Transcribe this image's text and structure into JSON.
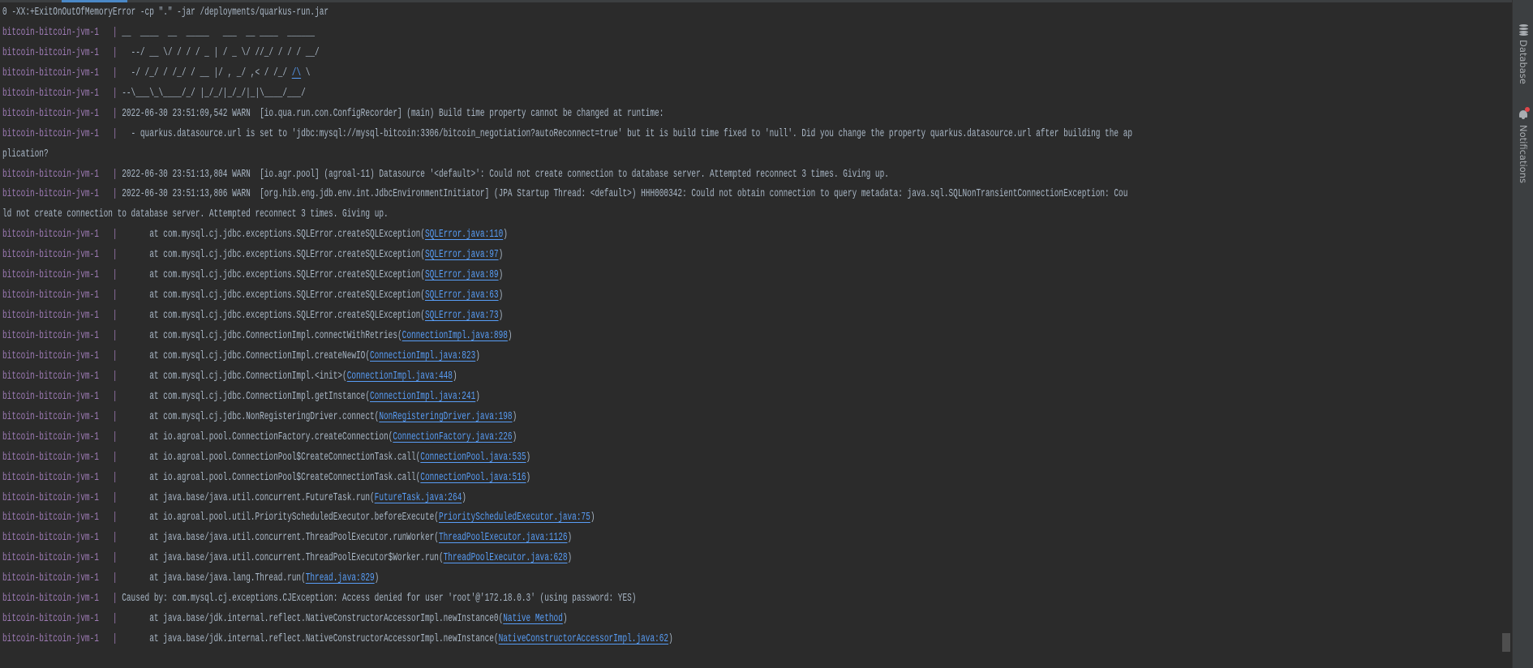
{
  "colors": {
    "background": "#2b2b2b",
    "text": "#a9b7c6",
    "prefix": "#9e7bb5",
    "link": "#589df6",
    "sidebar": "#3c3f41",
    "notification_dot": "#e0464a"
  },
  "sidebar": {
    "items": [
      {
        "label": "Database",
        "icon": "database-icon"
      },
      {
        "label": "Notifications",
        "icon": "bell-icon",
        "has_badge": true
      }
    ]
  },
  "console": {
    "lines": [
      {
        "msg": "0 -XX:+ExitOnOutOfMemoryError -cp \".\" -jar /deployments/quarkus-run.jar"
      },
      {
        "prefix": "bitcoin-bitcoin-jvm-1",
        "sep": "|",
        "msg": "__  ____  __  _____   ___  __ ____  ______"
      },
      {
        "prefix": "bitcoin-bitcoin-jvm-1",
        "sep": "|",
        "msg": "  --/ __ \\/ / / / _ | / _ \\/ //_/ / / / __/"
      },
      {
        "prefix": "bitcoin-bitcoin-jvm-1",
        "sep": "|",
        "msg": "  -/ /_/ / /_/ / __ |/ , _/ ,< / /_/ ",
        "link": "/\\",
        "tail": " \\"
      },
      {
        "prefix": "bitcoin-bitcoin-jvm-1",
        "sep": "|",
        "msg": "--\\___\\_\\____/_/ |_/_/|_/_/|_|\\____/___/"
      },
      {
        "prefix": "bitcoin-bitcoin-jvm-1",
        "sep": "|",
        "msg": "2022-06-30 23:51:09,542 WARN  [io.qua.run.con.ConfigRecorder] (main) Build time property cannot be changed at runtime:"
      },
      {
        "prefix": "bitcoin-bitcoin-jvm-1",
        "sep": "|",
        "msg": "  - quarkus.datasource.url is set to 'jdbc:mysql://mysql-bitcoin:3306/bitcoin_negotiation?autoReconnect=true' but it is build time fixed to 'null'. Did you change the property quarkus.datasource.url after building the ap"
      },
      {
        "msg": "plication?"
      },
      {
        "prefix": "bitcoin-bitcoin-jvm-1",
        "sep": "|",
        "msg": "2022-06-30 23:51:13,804 WARN  [io.agr.pool] (agroal-11) Datasource '<default>': Could not create connection to database server. Attempted reconnect 3 times. Giving up."
      },
      {
        "prefix": "bitcoin-bitcoin-jvm-1",
        "sep": "|",
        "msg": "2022-06-30 23:51:13,806 WARN  [org.hib.eng.jdb.env.int.JdbcEnvironmentInitiator] (JPA Startup Thread: <default>) HHH000342: Could not obtain connection to query metadata: java.sql.SQLNonTransientConnectionException: Cou"
      },
      {
        "msg": "ld not create connection to database server. Attempted reconnect 3 times. Giving up."
      },
      {
        "prefix": "bitcoin-bitcoin-jvm-1",
        "sep": "|",
        "msg": "      at com.mysql.cj.jdbc.exceptions.SQLError.createSQLException(",
        "link": "SQLError.java:110",
        "tail": ")"
      },
      {
        "prefix": "bitcoin-bitcoin-jvm-1",
        "sep": "|",
        "msg": "      at com.mysql.cj.jdbc.exceptions.SQLError.createSQLException(",
        "link": "SQLError.java:97",
        "tail": ")"
      },
      {
        "prefix": "bitcoin-bitcoin-jvm-1",
        "sep": "|",
        "msg": "      at com.mysql.cj.jdbc.exceptions.SQLError.createSQLException(",
        "link": "SQLError.java:89",
        "tail": ")"
      },
      {
        "prefix": "bitcoin-bitcoin-jvm-1",
        "sep": "|",
        "msg": "      at com.mysql.cj.jdbc.exceptions.SQLError.createSQLException(",
        "link": "SQLError.java:63",
        "tail": ")"
      },
      {
        "prefix": "bitcoin-bitcoin-jvm-1",
        "sep": "|",
        "msg": "      at com.mysql.cj.jdbc.exceptions.SQLError.createSQLException(",
        "link": "SQLError.java:73",
        "tail": ")"
      },
      {
        "prefix": "bitcoin-bitcoin-jvm-1",
        "sep": "|",
        "msg": "      at com.mysql.cj.jdbc.ConnectionImpl.connectWithRetries(",
        "link": "ConnectionImpl.java:898",
        "tail": ")"
      },
      {
        "prefix": "bitcoin-bitcoin-jvm-1",
        "sep": "|",
        "msg": "      at com.mysql.cj.jdbc.ConnectionImpl.createNewIO(",
        "link": "ConnectionImpl.java:823",
        "tail": ")"
      },
      {
        "prefix": "bitcoin-bitcoin-jvm-1",
        "sep": "|",
        "msg": "      at com.mysql.cj.jdbc.ConnectionImpl.<init>(",
        "link": "ConnectionImpl.java:448",
        "tail": ")"
      },
      {
        "prefix": "bitcoin-bitcoin-jvm-1",
        "sep": "|",
        "msg": "      at com.mysql.cj.jdbc.ConnectionImpl.getInstance(",
        "link": "ConnectionImpl.java:241",
        "tail": ")"
      },
      {
        "prefix": "bitcoin-bitcoin-jvm-1",
        "sep": "|",
        "msg": "      at com.mysql.cj.jdbc.NonRegisteringDriver.connect(",
        "link": "NonRegisteringDriver.java:198",
        "tail": ")"
      },
      {
        "prefix": "bitcoin-bitcoin-jvm-1",
        "sep": "|",
        "msg": "      at io.agroal.pool.ConnectionFactory.createConnection(",
        "link": "ConnectionFactory.java:226",
        "tail": ")"
      },
      {
        "prefix": "bitcoin-bitcoin-jvm-1",
        "sep": "|",
        "msg": "      at io.agroal.pool.ConnectionPool$CreateConnectionTask.call(",
        "link": "ConnectionPool.java:535",
        "tail": ")"
      },
      {
        "prefix": "bitcoin-bitcoin-jvm-1",
        "sep": "|",
        "msg": "      at io.agroal.pool.ConnectionPool$CreateConnectionTask.call(",
        "link": "ConnectionPool.java:516",
        "tail": ")"
      },
      {
        "prefix": "bitcoin-bitcoin-jvm-1",
        "sep": "|",
        "msg": "      at java.base/java.util.concurrent.FutureTask.run(",
        "link": "FutureTask.java:264",
        "tail": ")"
      },
      {
        "prefix": "bitcoin-bitcoin-jvm-1",
        "sep": "|",
        "msg": "      at io.agroal.pool.util.PriorityScheduledExecutor.beforeExecute(",
        "link": "PriorityScheduledExecutor.java:75",
        "tail": ")"
      },
      {
        "prefix": "bitcoin-bitcoin-jvm-1",
        "sep": "|",
        "msg": "      at java.base/java.util.concurrent.ThreadPoolExecutor.runWorker(",
        "link": "ThreadPoolExecutor.java:1126",
        "tail": ")"
      },
      {
        "prefix": "bitcoin-bitcoin-jvm-1",
        "sep": "|",
        "msg": "      at java.base/java.util.concurrent.ThreadPoolExecutor$Worker.run(",
        "link": "ThreadPoolExecutor.java:628",
        "tail": ")"
      },
      {
        "prefix": "bitcoin-bitcoin-jvm-1",
        "sep": "|",
        "msg": "      at java.base/java.lang.Thread.run(",
        "link": "Thread.java:829",
        "tail": ")"
      },
      {
        "prefix": "bitcoin-bitcoin-jvm-1",
        "sep": "|",
        "msg": "Caused by: com.mysql.cj.exceptions.CJException: Access denied for user 'root'@'172.18.0.3' (using password: YES)"
      },
      {
        "prefix": "bitcoin-bitcoin-jvm-1",
        "sep": "|",
        "msg": "      at java.base/jdk.internal.reflect.NativeConstructorAccessorImpl.newInstance0(",
        "link": "Native Method",
        "tail": ")"
      },
      {
        "prefix": "bitcoin-bitcoin-jvm-1",
        "sep": "|",
        "msg": "      at java.base/jdk.internal.reflect.NativeConstructorAccessorImpl.newInstance(",
        "link": "NativeConstructorAccessorImpl.java:62",
        "tail": ")"
      }
    ]
  }
}
